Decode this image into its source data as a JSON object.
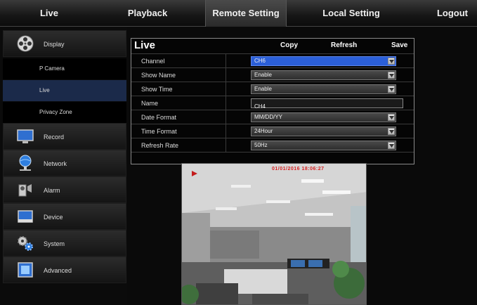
{
  "nav": {
    "live": "Live",
    "playback": "Playback",
    "remote_setting": "Remote Setting",
    "local_setting": "Local Setting",
    "logout": "Logout"
  },
  "sidebar": {
    "display": "Display",
    "sub": {
      "ip_camera": "P Camera",
      "live": "Live",
      "privacy_zone": "Privacy Zone"
    },
    "record": "Record",
    "network": "Network",
    "alarm": "Alarm",
    "device": "Device",
    "system": "System",
    "advanced": "Advanced"
  },
  "panel": {
    "title": "Live",
    "copy": "Copy",
    "refresh": "Refresh",
    "save": "Save",
    "rows": {
      "channel": {
        "label": "Channel",
        "value": "CH6"
      },
      "show_name": {
        "label": "Show Name",
        "value": "Enable"
      },
      "show_time": {
        "label": "Show Time",
        "value": "Enable"
      },
      "name": {
        "label": "Name",
        "value": "CH4"
      },
      "date_format": {
        "label": "Date Format",
        "value": "MM/DD/YY"
      },
      "time_format": {
        "label": "Time Format",
        "value": "24Hour"
      },
      "refresh_rate": {
        "label": "Refresh Rate",
        "value": "50Hz"
      }
    }
  },
  "preview": {
    "osd_text": "01/01/2016 18:06:27"
  },
  "colors": {
    "selected_field": "#2b5fd8",
    "active_sub_item": "#1b2a4a"
  }
}
